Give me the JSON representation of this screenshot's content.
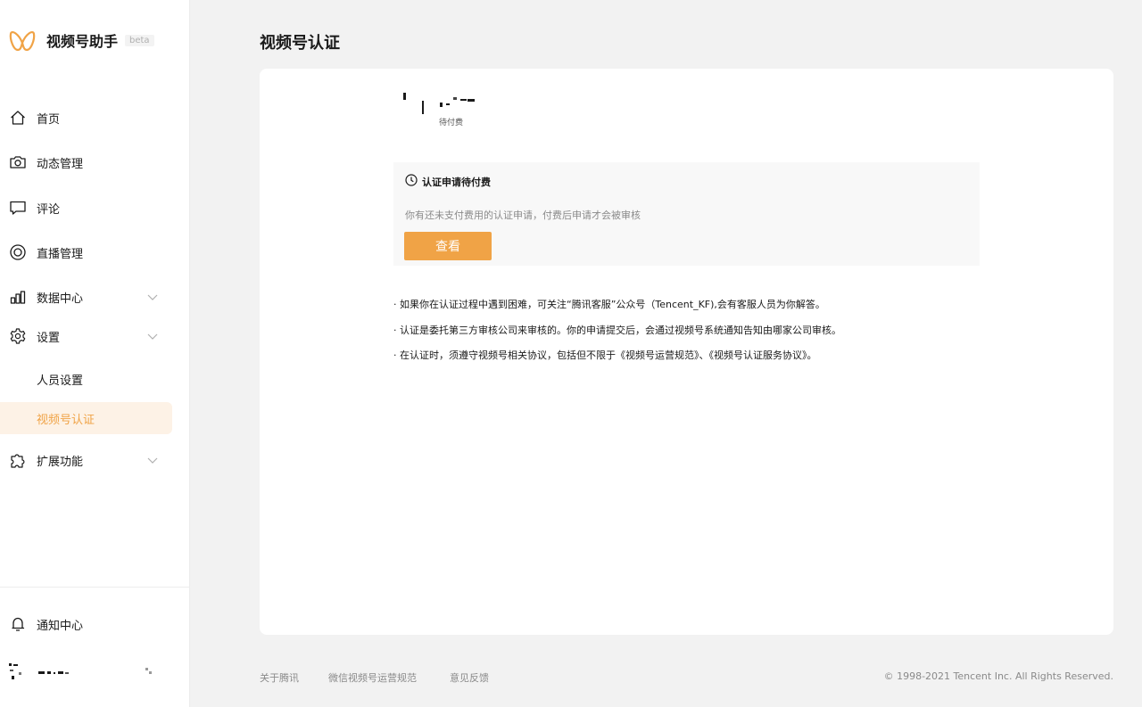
{
  "brand": {
    "name": "视频号助手",
    "badge": "beta",
    "logo_icon": "butterfly-logo-icon",
    "accent": "#f0a346"
  },
  "sidebar": {
    "items": [
      {
        "label": "首页",
        "icon": "home-icon",
        "expandable": false
      },
      {
        "label": "动态管理",
        "icon": "camera-icon",
        "expandable": false
      },
      {
        "label": "评论",
        "icon": "comment-icon",
        "expandable": false
      },
      {
        "label": "直播管理",
        "icon": "live-icon",
        "expandable": false
      },
      {
        "label": "数据中心",
        "icon": "bar-chart-icon",
        "expandable": true
      },
      {
        "label": "设置",
        "icon": "gear-icon",
        "expandable": true
      },
      {
        "label": "人员设置",
        "sub": true
      },
      {
        "label": "视频号认证",
        "sub": true,
        "active": true
      },
      {
        "label": "扩展功能",
        "icon": "puzzle-icon",
        "expandable": true
      }
    ],
    "notification": {
      "label": "通知中心",
      "icon": "bell-icon"
    }
  },
  "page": {
    "title": "视频号认证"
  },
  "status": {
    "text": "待付费"
  },
  "notice": {
    "icon": "clock-icon",
    "title": "认证申请待付费",
    "description": "你有还未支付费用的认证申请，付费后申请才会被审核",
    "button_label": "查看"
  },
  "tips": [
    "· 如果你在认证过程中遇到困难，可关注“腾讯客服”公众号（Tencent_KF),会有客服人员为你解答。",
    "· 认证是委托第三方审核公司来审核的。你的申请提交后，会通过视频号系统通知告知由哪家公司审核。",
    "· 在认证时，须遵守视频号相关协议，包括但不限于《视频号运营规范》、《视频号认证服务协议》。"
  ],
  "footer": {
    "links": [
      "关于腾讯",
      "微信视频号运营规范",
      "意见反馈"
    ],
    "copyright": "© 1998-2021 Tencent Inc. All Rights Reserved."
  }
}
